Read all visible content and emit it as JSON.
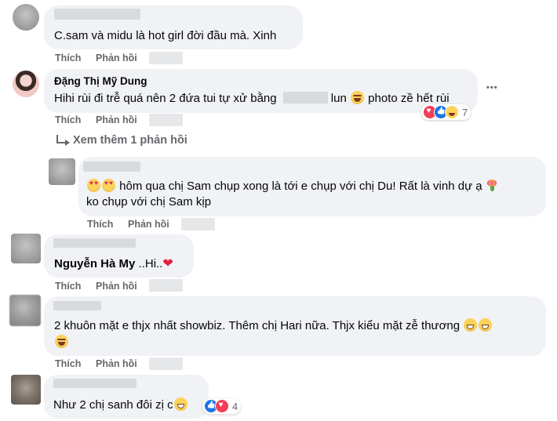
{
  "comments": [
    {
      "text": "C.sam và midu là hot girl đời đầu mà. Xinh",
      "actions": {
        "like": "Thích",
        "reply": "Phản hồi"
      }
    },
    {
      "name": "Đặng Thị Mỹ Dung",
      "text_before": "Hihi rùi đi trễ quá nên 2 đứa tui tự xử bằng",
      "text_after": "lun",
      "text_end": "photo zề hết rùi",
      "reaction_count": "7",
      "more": "•••",
      "actions": {
        "like": "Thích",
        "reply": "Phản hồi"
      },
      "view_more": "Xem thêm 1 phản hồi"
    },
    {
      "line1": "hôm qua chị Sam chụp xong là tới e chụp với chị Du! Rất là vinh dự ạ",
      "line2": "ko chụp với chị Sam kịp",
      "actions": {
        "like": "Thích",
        "reply": "Phản hồi"
      }
    },
    {
      "text_name": "Nguyễn Hà My",
      "text_rest": " ..Hi..",
      "actions": {
        "like": "Thích",
        "reply": "Phản hồi"
      }
    },
    {
      "line1": "2 khuôn mặt e thjx nhất showbiz. Thêm chị Hari nữa. Thjx kiểu mặt zễ thương",
      "actions": {
        "like": "Thích",
        "reply": "Phản hồi"
      }
    },
    {
      "text": "Như 2 chị sanh đôi zị c",
      "reaction_count": "4"
    }
  ],
  "icons": {
    "love_color": "#f33e58",
    "like_color": "#1b74e4",
    "haha_color": "#fbd35a",
    "heart_color": "#e41e3f"
  }
}
